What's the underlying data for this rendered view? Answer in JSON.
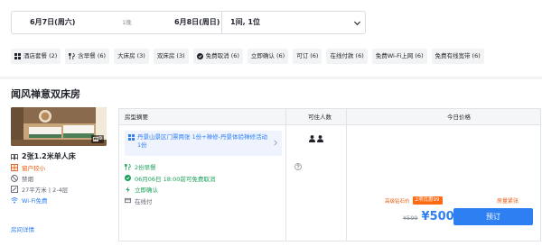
{
  "search": {
    "checkin": "6月7日(周六)",
    "nights": "1晚",
    "checkout": "6月8日(周日)",
    "rooms_guests": "1间, 1位"
  },
  "filters": [
    {
      "label": "酒店套餐 (2)",
      "icon": "grid-icon"
    },
    {
      "label": "含早餐 (6)",
      "icon": "cutlery-icon"
    },
    {
      "label": "大床房 (3)",
      "icon": ""
    },
    {
      "label": "双床房 (3)",
      "icon": ""
    },
    {
      "label": "免费取消 (6)",
      "icon": "cancel-icon"
    },
    {
      "label": "立即确认 (6)",
      "icon": ""
    },
    {
      "label": "可订 (6)",
      "icon": ""
    },
    {
      "label": "在线付款 (6)",
      "icon": ""
    },
    {
      "label": "免费Wi-Fi上网 (6)",
      "icon": ""
    },
    {
      "label": "免费有线宽带 (6)",
      "icon": ""
    }
  ],
  "room": {
    "title": "闻风禅意双床房",
    "photo_count": "9",
    "bed": "2张1.2米单人床",
    "window": "窗户较小",
    "smoking": "禁烟",
    "area_floor": "27平方米 | 2-4层",
    "wifi": "Wi-Fi免费",
    "detail_link": "房间详情"
  },
  "rate_table": {
    "col_summary": "房型摘要",
    "col_guests": "可住人数",
    "col_price": "今日价格",
    "package": "丹景山景区门票两张 1份+禅修-丹景体验禅修活动 1份",
    "perks": {
      "breakfast": "2份早餐",
      "cancel": "06月06日 18:00前可免费取消",
      "confirm": "立即确认",
      "payment": "在线付"
    },
    "promo_label": "高级钻石价",
    "coupon": "2项优惠99",
    "sold_badge": "房量紧张",
    "price_original": "¥599",
    "price_current": "¥500",
    "book_label": "预订"
  },
  "colors": {
    "primary": "#2e7ff2",
    "green": "#18a058",
    "orange": "#ff6a13"
  }
}
